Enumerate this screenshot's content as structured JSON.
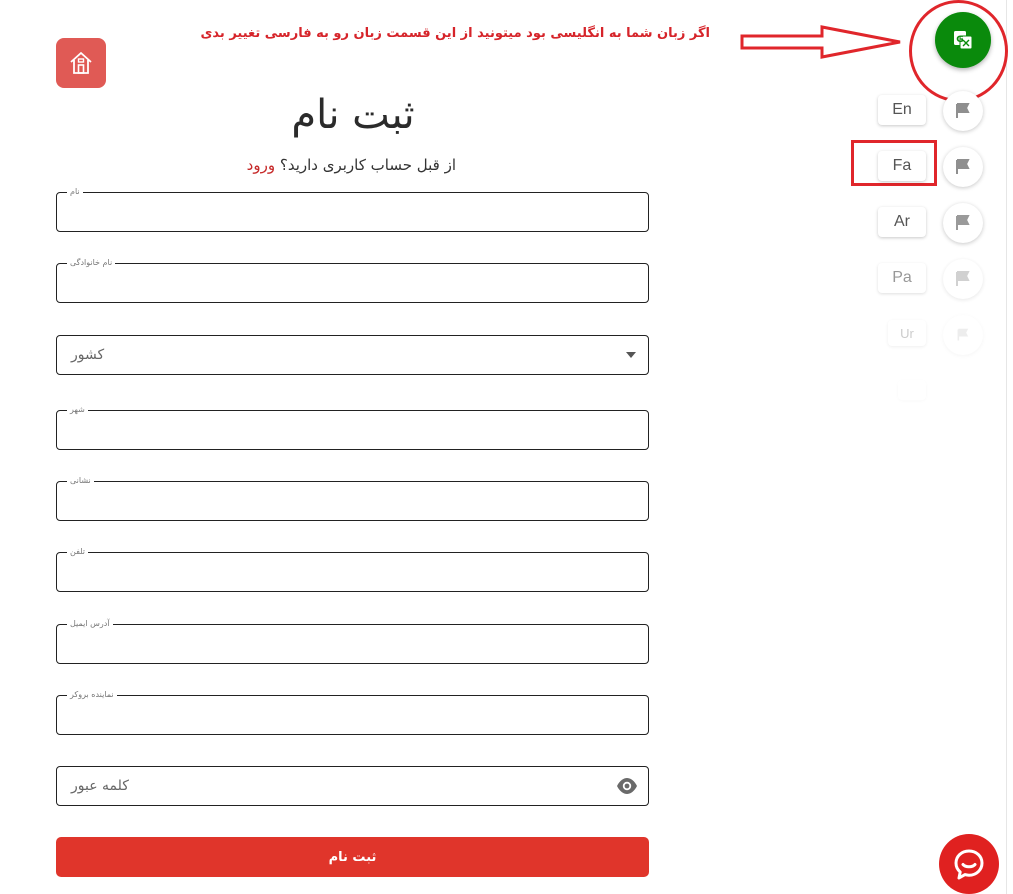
{
  "annotation": {
    "text": "اگر زبان شما به انگلیسی بود میتونید از این قسمت زبان رو به فارسی تغییر بدی",
    "color": "#d6242a"
  },
  "header": {
    "title": "ثبت نام",
    "login_prompt": "از قبل حساب کاربری دارید؟",
    "login_link": "ورود"
  },
  "form": {
    "first_name_label": "نام",
    "last_name_label": "نام خانوادگی",
    "country_placeholder": "کشور",
    "city_label": "شهر",
    "address_label": "نشانی",
    "phone_label": "تلفن",
    "email_label": "آدرس ایمیل",
    "broker_label": "نماینده بروکر",
    "password_placeholder": "کلمه عبور",
    "submit_label": "ثبت نام"
  },
  "languages": [
    {
      "code": "En"
    },
    {
      "code": "Fa"
    },
    {
      "code": "Ar"
    },
    {
      "code": "Pa"
    },
    {
      "code": "Ur"
    }
  ],
  "icons": {
    "home": "home-icon",
    "translate": "translate-icon",
    "flag": "flag-icon",
    "dropdown": "caret-down-icon",
    "eye": "eye-icon",
    "chat": "chat-icon"
  },
  "colors": {
    "accent": "#e0352b",
    "home_bg": "#e05a55",
    "translate_bg": "#0a8a0c",
    "annotation": "#e0262b"
  }
}
